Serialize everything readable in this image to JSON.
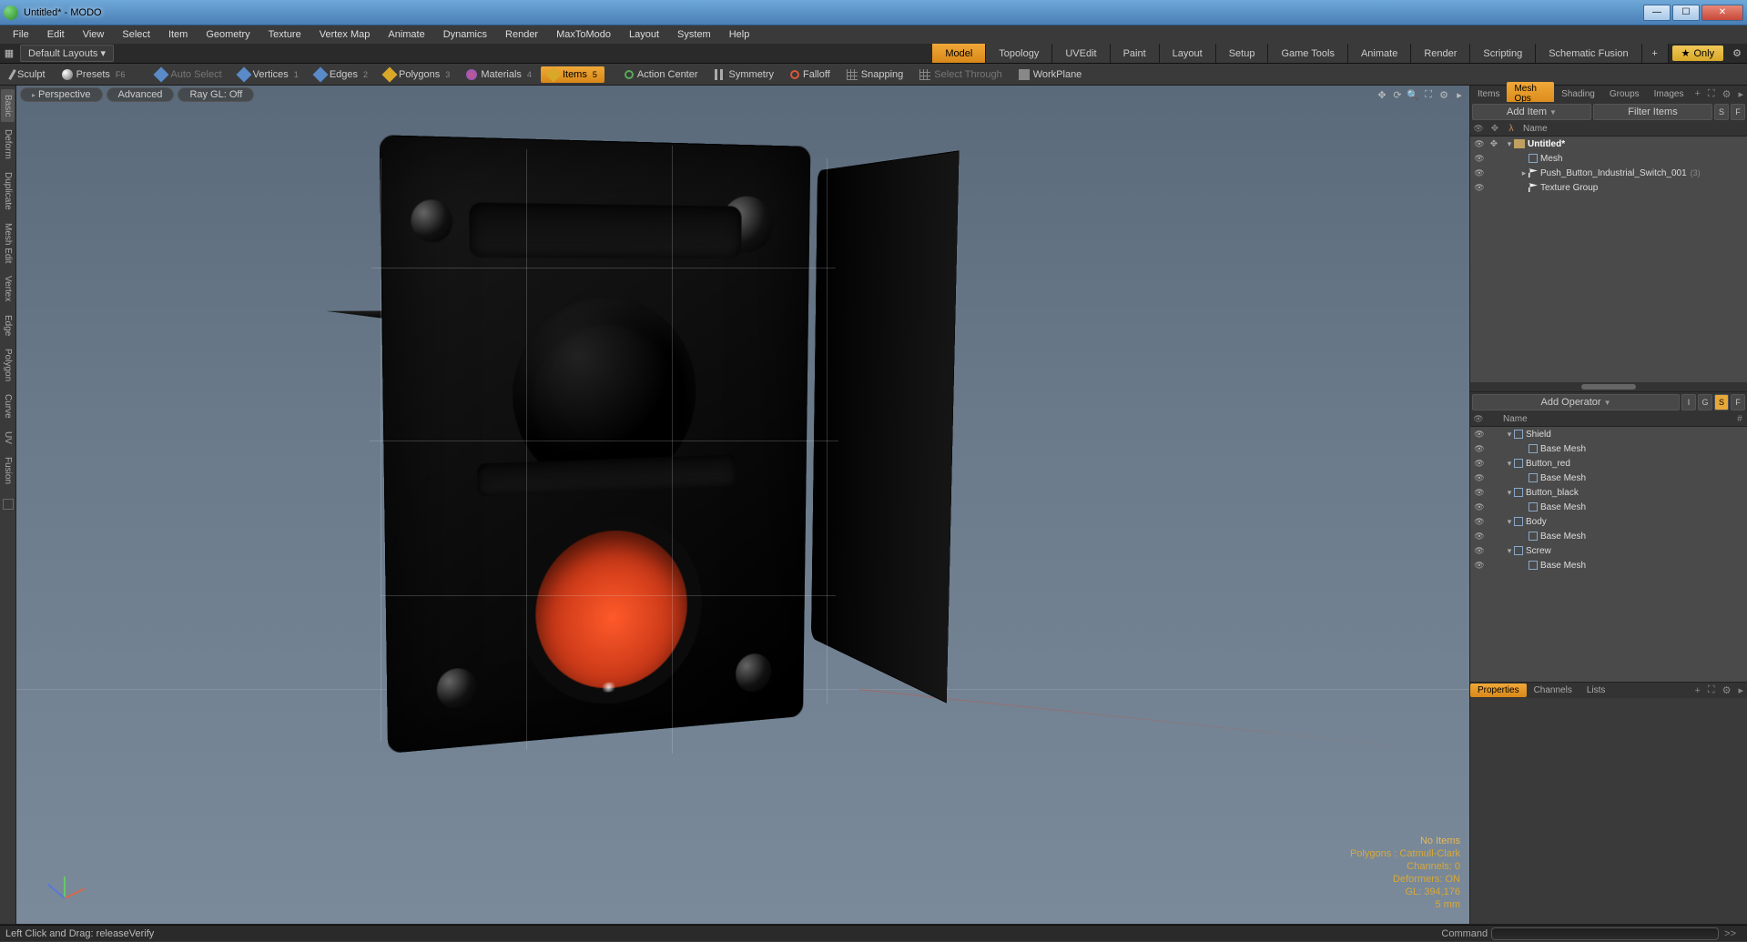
{
  "window": {
    "title": "Untitled* - MODO"
  },
  "menubar": [
    "File",
    "Edit",
    "View",
    "Select",
    "Item",
    "Geometry",
    "Texture",
    "Vertex Map",
    "Animate",
    "Dynamics",
    "Render",
    "MaxToModo",
    "Layout",
    "System",
    "Help"
  ],
  "layoutrow": {
    "default": "Default Layouts ▾",
    "tabs": [
      "Model",
      "Topology",
      "UVEdit",
      "Paint",
      "Layout",
      "Setup",
      "Game Tools",
      "Animate",
      "Render",
      "Scripting",
      "Schematic Fusion"
    ],
    "active": "Model",
    "only": "Only"
  },
  "ribbon": {
    "sculpt": "Sculpt",
    "presets": "Presets",
    "presets_key": "F6",
    "autoselect": "Auto Select",
    "vertices": "Vertices",
    "vertices_key": "1",
    "edges": "Edges",
    "edges_key": "2",
    "polygons": "Polygons",
    "polygons_key": "3",
    "materials": "Materials",
    "materials_key": "4",
    "items": "Items",
    "items_key": "5",
    "actioncenter": "Action Center",
    "symmetry": "Symmetry",
    "falloff": "Falloff",
    "snapping": "Snapping",
    "selectthrough": "Select Through",
    "workplane": "WorkPlane"
  },
  "verticalTabs": [
    "Basic",
    "Deform",
    "Duplicate",
    "Mesh Edit",
    "Vertex",
    "Edge",
    "Polygon",
    "Curve",
    "UV",
    "Fusion"
  ],
  "viewport": {
    "chips": {
      "perspective": "Perspective",
      "advanced": "Advanced",
      "raygl": "Ray GL: Off"
    },
    "status": {
      "noitems": "No Items",
      "poly": "Polygons : Catmull-Clark",
      "chan": "Channels: 0",
      "deform": "Deformers: ON",
      "gl": "GL: 394,176",
      "unit": "5 mm"
    }
  },
  "rightTop": {
    "tabs": [
      "Items",
      "Mesh Ops",
      "Shading",
      "Groups",
      "Images"
    ],
    "active": "Mesh Ops",
    "additem": "Add Item",
    "filter": "Filter Items",
    "btn_s": "S",
    "btn_f": "F",
    "col_name": "Name",
    "tree": [
      {
        "depth": 0,
        "kind": "scene",
        "exp": "▾",
        "label": "Untitled*",
        "bold": true,
        "eye": true,
        "plus": true
      },
      {
        "depth": 1,
        "kind": "mesh",
        "exp": "",
        "label": "Mesh",
        "eye": true
      },
      {
        "depth": 1,
        "kind": "flag",
        "exp": "▸",
        "label": "Push_Button_Industrial_Switch_001",
        "count": "(3)",
        "eye": true
      },
      {
        "depth": 1,
        "kind": "flag",
        "exp": "",
        "label": "Texture Group",
        "eye": true
      }
    ]
  },
  "rightMid": {
    "addop": "Add Operator",
    "btn_i": "I",
    "btn_g": "G",
    "btn_s": "S",
    "btn_f": "F",
    "col_name": "Name",
    "col_hash": "#",
    "tree": [
      {
        "depth": 0,
        "exp": "▾",
        "kind": "mesh",
        "label": "Shield"
      },
      {
        "depth": 1,
        "exp": "",
        "kind": "base",
        "label": "Base Mesh"
      },
      {
        "depth": 0,
        "exp": "▾",
        "kind": "mesh",
        "label": "Button_red"
      },
      {
        "depth": 1,
        "exp": "",
        "kind": "base",
        "label": "Base Mesh"
      },
      {
        "depth": 0,
        "exp": "▾",
        "kind": "mesh",
        "label": "Button_black"
      },
      {
        "depth": 1,
        "exp": "",
        "kind": "base",
        "label": "Base Mesh"
      },
      {
        "depth": 0,
        "exp": "▾",
        "kind": "mesh",
        "label": "Body"
      },
      {
        "depth": 1,
        "exp": "",
        "kind": "base",
        "label": "Base Mesh"
      },
      {
        "depth": 0,
        "exp": "▾",
        "kind": "mesh",
        "label": "Screw"
      },
      {
        "depth": 1,
        "exp": "",
        "kind": "base",
        "label": "Base Mesh"
      }
    ]
  },
  "rightBottom": {
    "tabs": [
      "Properties",
      "Channels",
      "Lists"
    ],
    "active": "Properties"
  },
  "status": {
    "hint": "Left Click and Drag:   releaseVerify",
    "cmd": "Command",
    "go": ">>"
  }
}
